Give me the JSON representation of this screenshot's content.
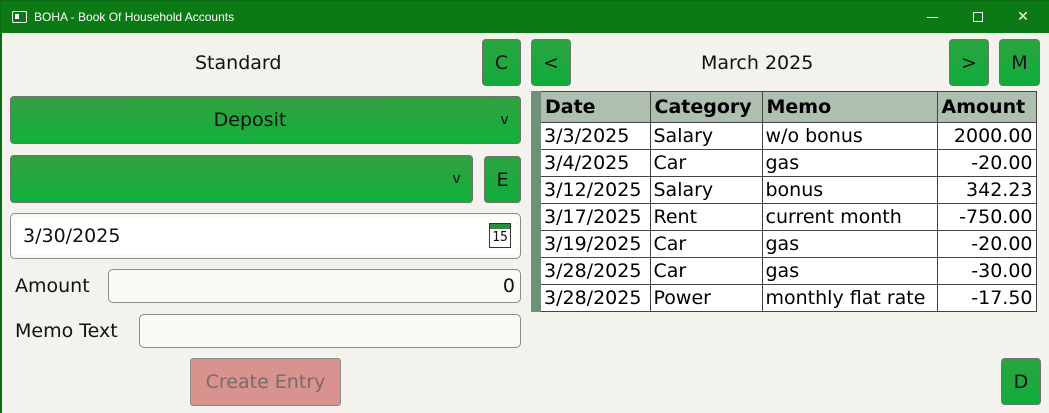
{
  "window": {
    "title": "BOHA - Book Of Household Accounts"
  },
  "left": {
    "mode_title": "Standard",
    "c_button": "C",
    "type_combo": {
      "value": "Deposit",
      "arrow": "v"
    },
    "category_combo": {
      "value": "",
      "arrow": "v"
    },
    "e_button": "E",
    "date_value": "3/30/2025",
    "calendar_day": "15",
    "amount_label": "Amount",
    "amount_value": "0",
    "memo_label": "Memo Text",
    "memo_value": "",
    "create_button": "Create Entry"
  },
  "right": {
    "prev_button": "<",
    "next_button": ">",
    "m_button": "M",
    "month_title": "March 2025",
    "d_button": "D",
    "table": {
      "headers": [
        "Date",
        "Category",
        "Memo",
        "Amount"
      ],
      "rows": [
        [
          "3/3/2025",
          "Salary",
          "w/o bonus",
          "2000.00"
        ],
        [
          "3/4/2025",
          "Car",
          "gas",
          "-20.00"
        ],
        [
          "3/12/2025",
          "Salary",
          "bonus",
          "342.23"
        ],
        [
          "3/17/2025",
          "Rent",
          "current month",
          "-750.00"
        ],
        [
          "3/19/2025",
          "Car",
          "gas",
          "-20.00"
        ],
        [
          "3/28/2025",
          "Car",
          "gas",
          "-30.00"
        ],
        [
          "3/28/2025",
          "Power",
          "monthly flat rate",
          "-17.50"
        ]
      ]
    }
  },
  "colors": {
    "titlebar": "#0b7a14",
    "button_green": "#10ad3b",
    "disabled_button": "#d9938f",
    "table_header": "#aebfb0",
    "background": "#f4f2ed"
  }
}
